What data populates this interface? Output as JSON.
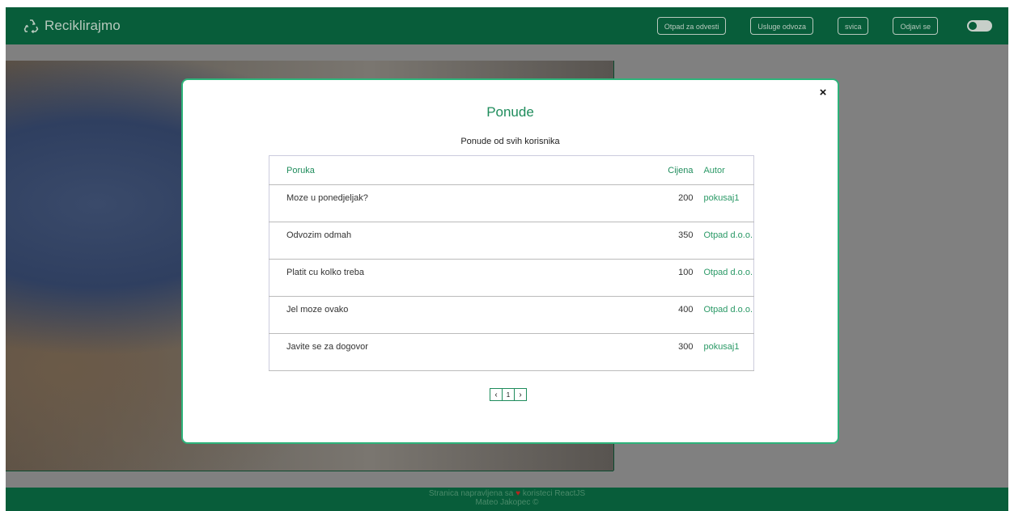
{
  "header": {
    "brand": "Reciklirajmo",
    "brand_icon": "recycle-icon",
    "nav": [
      {
        "label": "Otpad za odvesti"
      },
      {
        "label": "Usluge odvoza"
      },
      {
        "label": "svica"
      },
      {
        "label": "Odjavi se"
      }
    ],
    "theme_toggle_icon": "toggle-icon"
  },
  "modal": {
    "title": "Ponude",
    "subtitle": "Ponude od svih korisnika",
    "close_icon": "close-icon",
    "close_label": "×",
    "columns": {
      "message": "Poruka",
      "price": "Cijena",
      "author": "Autor"
    },
    "rows": [
      {
        "message": "Moze u ponedjeljak?",
        "price": "200",
        "author": "pokusaj1"
      },
      {
        "message": "Odvozim odmah",
        "price": "350",
        "author": "Otpad d.o.o."
      },
      {
        "message": "Platit cu kolko treba",
        "price": "100",
        "author": "Otpad d.o.o."
      },
      {
        "message": "Jel moze ovako",
        "price": "400",
        "author": "Otpad d.o.o."
      },
      {
        "message": "Javite se za dogovor",
        "price": "300",
        "author": "pokusaj1"
      }
    ],
    "pagination": {
      "prev": "‹",
      "page": "1",
      "next": "›"
    }
  },
  "footer": {
    "line1_pre": "Stranica napravljena sa",
    "heart": "♥",
    "line1_post": "koristeci ReactJS",
    "line2": "Mateo Jakopec ©"
  },
  "colors": {
    "brand": "#085d3a",
    "accent": "#2db37a"
  }
}
